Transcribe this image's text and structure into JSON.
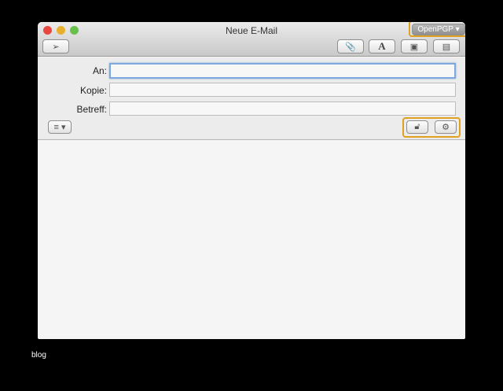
{
  "window": {
    "title": "Neue E-Mail"
  },
  "toolbar": {
    "openpgp_label": "OpenPGP ▾",
    "send_icon": "paper-plane-icon",
    "attach_icon": "paperclip-icon",
    "fonts_icon": "font-A-icon",
    "photo_icon": "photo-icon",
    "template_icon": "stationery-icon"
  },
  "fields": {
    "to_label": "An:",
    "cc_label": "Kopie:",
    "subject_label": "Betreff:",
    "to_value": "",
    "cc_value": "",
    "subject_value": ""
  },
  "options": {
    "format_label": "≡ ▾",
    "lock_icon": "unlocked-padlock-icon",
    "gear_icon": "gear-icon"
  },
  "highlight_color": "#e0a020",
  "caption": "blog"
}
